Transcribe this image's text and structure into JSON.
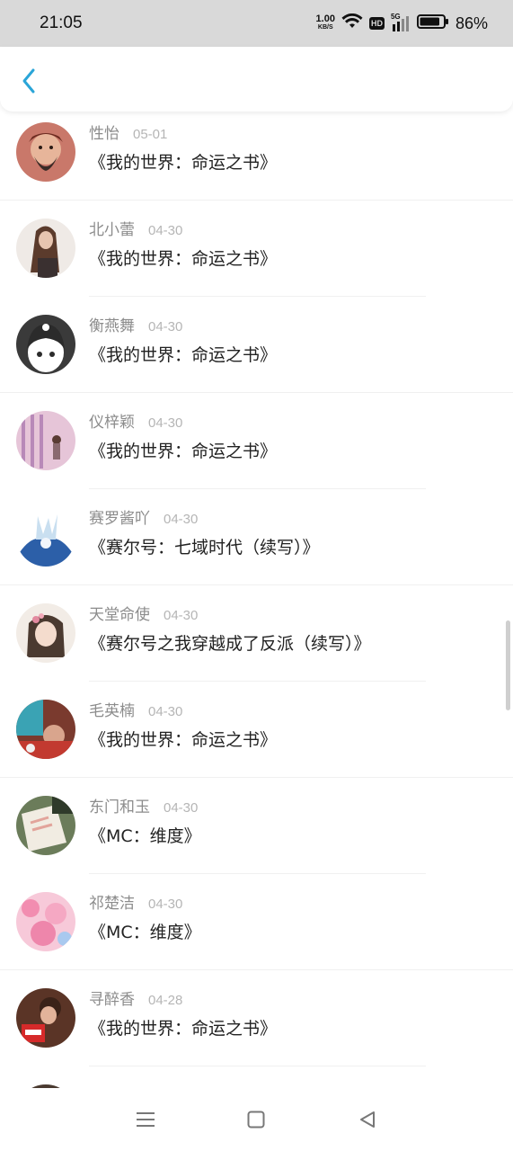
{
  "status_bar": {
    "time": "21:05",
    "net_speed_value": "1.00",
    "net_speed_unit": "KB/S",
    "hd_label": "HD",
    "signal_label": "5G",
    "battery_percent": "86%",
    "battery_level": 0.86
  },
  "header": {
    "back_icon": "chevron-left-icon",
    "accent_color": "#2aa5d8"
  },
  "rows": [
    {
      "name": "性怡",
      "date": "05-01",
      "title": "《我的世界：命运之书》",
      "avatar": "avatar-warrior"
    },
    {
      "name": "北小蕾",
      "date": "04-30",
      "title": "《我的世界：命运之书》",
      "avatar": "avatar-girl-hair"
    },
    {
      "name": "衡燕舞",
      "date": "04-30",
      "title": "《我的世界：命运之书》",
      "avatar": "avatar-cartoon"
    },
    {
      "name": "仪梓颖",
      "date": "04-30",
      "title": "《我的世界：命运之书》",
      "avatar": "avatar-pink-room"
    },
    {
      "name": "赛罗酱吖",
      "date": "04-30",
      "title": "《赛尔号：七域时代（续写）》",
      "avatar": "avatar-blue-anime"
    },
    {
      "name": "天堂命使",
      "date": "04-30",
      "title": "《赛尔号之我穿越成了反派（续写）》",
      "avatar": "avatar-anime-girl"
    },
    {
      "name": "毛英楠",
      "date": "04-30",
      "title": "《我的世界：命运之书》",
      "avatar": "avatar-red-photo"
    },
    {
      "name": "东门和玉",
      "date": "04-30",
      "title": "《MC：维度》",
      "avatar": "avatar-paper"
    },
    {
      "name": "祁楚洁",
      "date": "04-30",
      "title": "《MC：维度》",
      "avatar": "avatar-blossom"
    },
    {
      "name": "寻醉香",
      "date": "04-28",
      "title": "《我的世界：命运之书》",
      "avatar": "avatar-kfc"
    }
  ],
  "nav_bar": {
    "menu_icon": "menu-icon",
    "home_icon": "square-home-icon",
    "back_icon": "triangle-back-icon"
  }
}
